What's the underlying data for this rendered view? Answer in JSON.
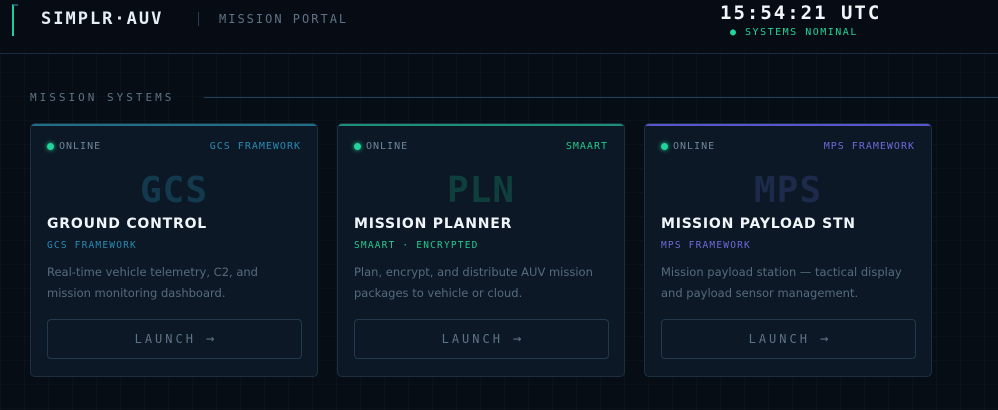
{
  "header": {
    "brand": "SIMPLR·AUV",
    "portal_label": "MISSION PORTAL",
    "clock": "15:54:21 UTC",
    "status": "● SYSTEMS NOMINAL"
  },
  "section": {
    "title": "MISSION SYSTEMS"
  },
  "cards": [
    {
      "status": "ONLINE",
      "tag": "GCS FRAMEWORK",
      "code": "GCS",
      "title": "GROUND CONTROL",
      "subtitle": "GCS FRAMEWORK",
      "description": "Real-time vehicle telemetry, C2, and mission monitoring dashboard.",
      "launch_label": "LAUNCH",
      "launch_arrow": "→",
      "accent": "#2a8ab4",
      "code_color": "#133a4c",
      "topline": "#1f6f86"
    },
    {
      "status": "ONLINE",
      "tag": "SMAART",
      "code": "PLN",
      "title": "MISSION PLANNER",
      "subtitle": "SMAART · ENCRYPTED",
      "description": "Plan, encrypt, and distribute AUV mission packages to vehicle or cloud.",
      "launch_label": "LAUNCH",
      "launch_arrow": "→",
      "accent": "#22c88e",
      "code_color": "#0f3f3c",
      "topline": "#1d8f78"
    },
    {
      "status": "ONLINE",
      "tag": "MPS FRAMEWORK",
      "code": "MPS",
      "title": "MISSION PAYLOAD STN",
      "subtitle": "MPS FRAMEWORK",
      "description": "Mission payload station — tactical display and payload sensor management.",
      "launch_label": "LAUNCH",
      "launch_arrow": "→",
      "accent": "#6c6ad8",
      "code_color": "#1d2a4a",
      "topline": "#5a55c8"
    }
  ]
}
